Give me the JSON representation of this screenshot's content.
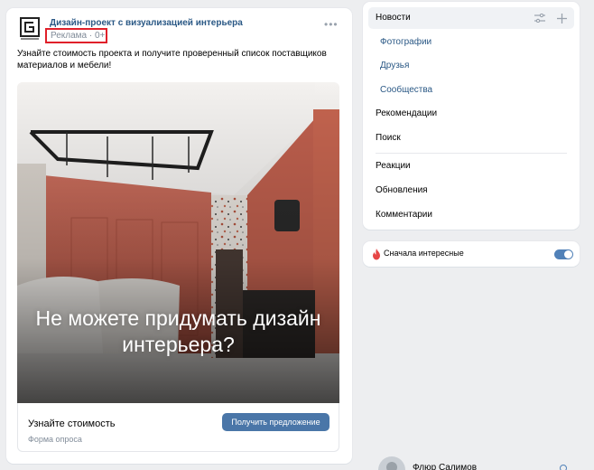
{
  "post": {
    "author": "Дизайн-проект с визуализацией интерьера",
    "meta": "Реклама · 0+",
    "text": "Узнайте стоимость проекта и получите проверенный список поставщиков материалов и мебели!",
    "image_headline": "Не можете придумать дизайн интерьера?",
    "footer_title": "Узнайте стоимость",
    "footer_subtitle": "Форма опроса",
    "cta_label": "Получить предложение",
    "more_icon": "more-horizontal-icon"
  },
  "nav": {
    "items": [
      {
        "label": "Новости"
      },
      {
        "label": "Фотографии"
      },
      {
        "label": "Друзья"
      },
      {
        "label": "Сообщества"
      },
      {
        "label": "Рекомендации"
      },
      {
        "label": "Поиск"
      },
      {
        "label": "Реакции"
      },
      {
        "label": "Обновления"
      },
      {
        "label": "Комментарии"
      }
    ],
    "icons": [
      "settings-sliders-icon",
      "plus-icon"
    ]
  },
  "filter": {
    "label": "Сначала интересные",
    "enabled": true,
    "icon": "fire-icon"
  },
  "friend": {
    "name": "Флюр Салимов"
  },
  "colors": {
    "background": "#edeef0",
    "link": "#2a5885",
    "accent": "#4a76a8",
    "highlight_border": "#e0202a"
  }
}
